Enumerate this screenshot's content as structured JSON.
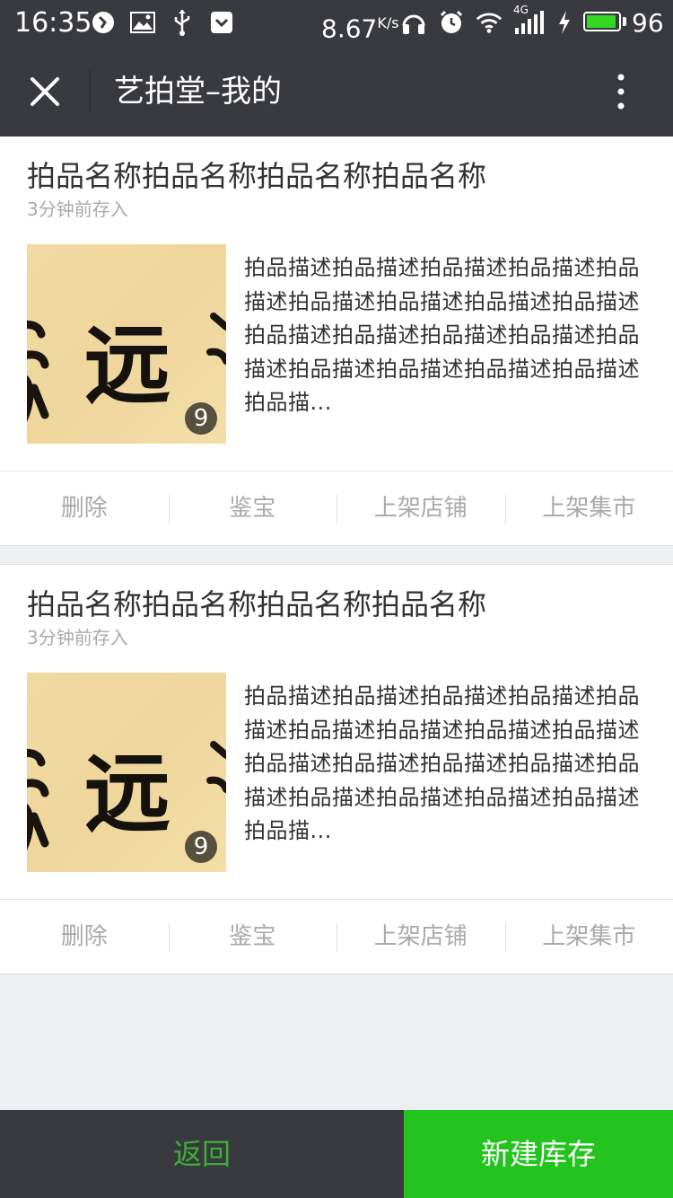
{
  "status_bar": {
    "time": "16:35",
    "speed_value": "8.67",
    "speed_unit": "K/s",
    "network_label": "4G",
    "battery_percent": "96",
    "battery_level": 0.96
  },
  "nav": {
    "title": "艺拍堂–我的",
    "close_icon": "close-icon",
    "more_icon": "more-vertical-icon"
  },
  "items": [
    {
      "title": "拍品名称拍品名称拍品名称拍品名称",
      "time": "3分钟前存入",
      "image_count": "9",
      "image_text": "远",
      "description": "拍品描述拍品描述拍品描述拍品描述拍品描述拍品描述拍品描述拍品描述拍品描述拍品描述拍品描述拍品描述拍品描述拍品描述拍品描述拍品描述拍品描述拍品描述拍品描...",
      "actions": [
        "删除",
        "鉴宝",
        "上架店铺",
        "上架集市"
      ]
    },
    {
      "title": "拍品名称拍品名称拍品名称拍品名称",
      "time": "3分钟前存入",
      "image_count": "9",
      "image_text": "远",
      "description": "拍品描述拍品描述拍品描述拍品描述拍品描述拍品描述拍品描述拍品描述拍品描述拍品描述拍品描述拍品描述拍品描述拍品描述拍品描述拍品描述拍品描述拍品描述拍品描...",
      "actions": [
        "删除",
        "鉴宝",
        "上架店铺",
        "上架集市"
      ]
    }
  ],
  "bottom_bar": {
    "back_label": "返回",
    "new_label": "新建库存"
  },
  "colors": {
    "bar_dark": "#393a3f",
    "accent_green": "#22c41d",
    "back_green": "#3cb034",
    "page_bg": "#eeeff2"
  }
}
